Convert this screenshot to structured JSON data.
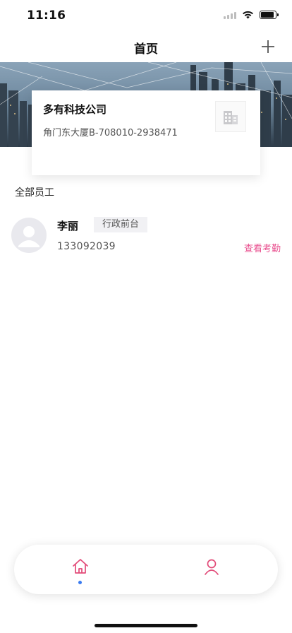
{
  "status_bar": {
    "time": "11:16"
  },
  "header": {
    "title": "首页",
    "add_icon": "plus-icon"
  },
  "company": {
    "name": "多有科技公司",
    "address": "角门东大厦B-708010-2938471",
    "logo_icon": "building-icon"
  },
  "employees_section": {
    "title": "全部员工",
    "items": [
      {
        "name": "李丽",
        "department": "行政前台",
        "phone": "133092039",
        "action_label": "查看考勤",
        "avatar_icon": "person-icon"
      }
    ]
  },
  "tab_bar": {
    "items": [
      {
        "icon": "home-icon",
        "active": true
      },
      {
        "icon": "person-icon",
        "active": false
      }
    ]
  },
  "colors": {
    "accent": "#e9508f",
    "tab_icon": "#e24a78",
    "active_dot": "#3a7bf0"
  }
}
